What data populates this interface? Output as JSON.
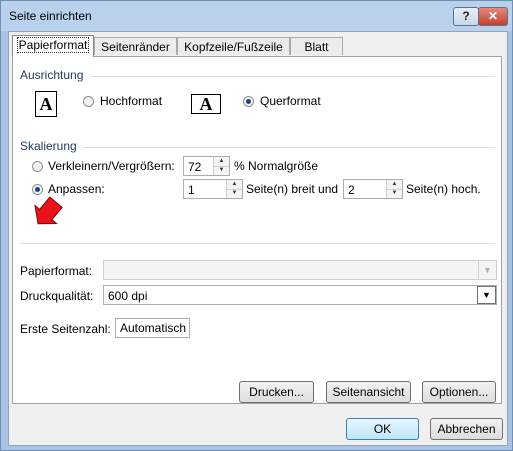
{
  "window": {
    "title": "Seite einrichten",
    "help_label": "?",
    "close_label": "✕"
  },
  "tabs": [
    {
      "label": "Papierformat",
      "active": true
    },
    {
      "label": "Seitenränder",
      "active": false
    },
    {
      "label": "Kopfzeile/Fußzeile",
      "active": false
    },
    {
      "label": "Blatt",
      "active": false
    }
  ],
  "orientation": {
    "group_label": "Ausrichtung",
    "portrait_label": "Hochformat",
    "landscape_label": "Querformat",
    "icon_letter": "A",
    "selected": "Querformat"
  },
  "scaling": {
    "group_label": "Skalierung",
    "adjust_label": "Verkleinern/Vergrößern:",
    "adjust_value": "72",
    "adjust_suffix": "% Normalgröße",
    "fit_label": "Anpassen:",
    "fit_wide_value": "1",
    "fit_wide_suffix": "Seite(n) breit und",
    "fit_tall_value": "2",
    "fit_tall_suffix": "Seite(n) hoch.",
    "selected": "Anpassen"
  },
  "paper_size": {
    "label": "Papierformat:",
    "value": ""
  },
  "print_quality": {
    "label": "Druckqualität:",
    "value": "600 dpi"
  },
  "first_page": {
    "label": "Erste Seitenzahl:",
    "value": "Automatisch"
  },
  "buttons": {
    "print": "Drucken...",
    "preview": "Seitenansicht",
    "options": "Optionen...",
    "ok": "OK",
    "cancel": "Abbrechen"
  },
  "annotation": {
    "arrow_color": "#e8121a"
  }
}
